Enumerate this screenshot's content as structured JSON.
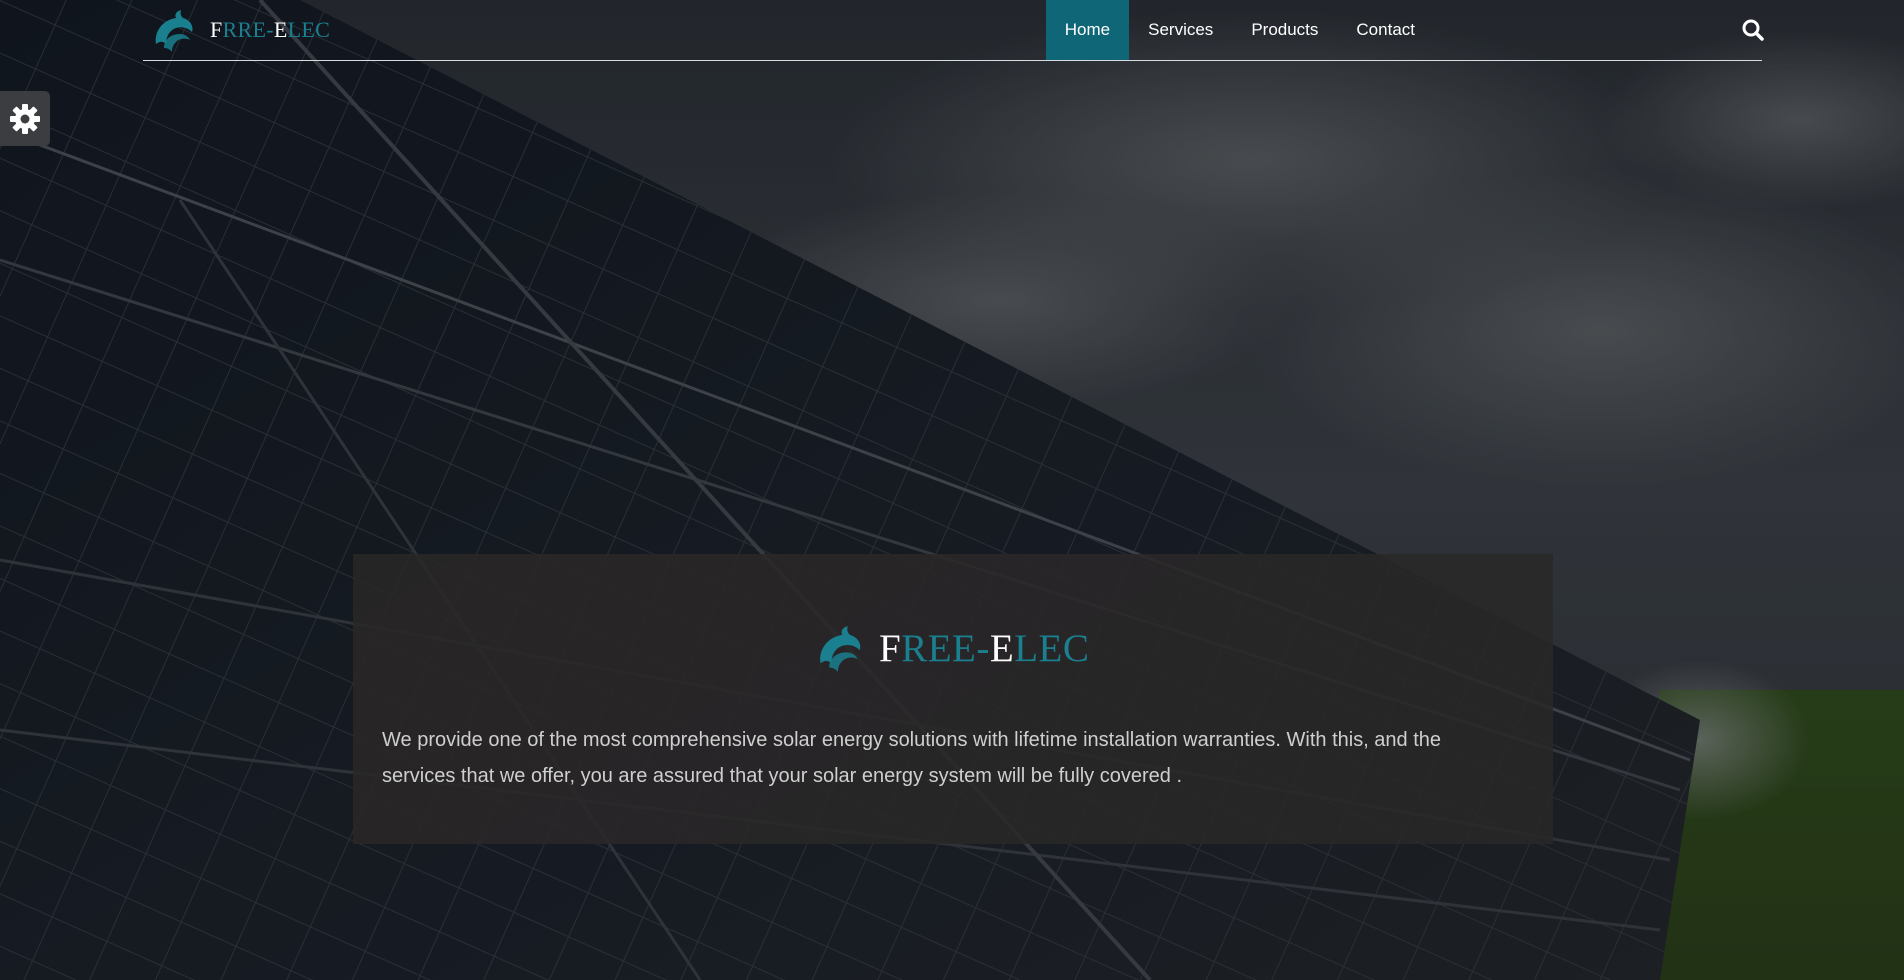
{
  "brand": {
    "parts": [
      "F",
      "RRE-",
      "E",
      "LEC"
    ],
    "colors": {
      "accent": "#1a7f8e",
      "white": "#ffffff"
    }
  },
  "nav": {
    "items": [
      {
        "label": "Home",
        "active": true
      },
      {
        "label": "Services",
        "active": false
      },
      {
        "label": "Products",
        "active": false
      },
      {
        "label": "Contact",
        "active": false
      }
    ],
    "search_icon": "search-icon",
    "active_color": "#0e6676"
  },
  "settings": {
    "icon": "gear-icon"
  },
  "hero": {
    "background": "solar-panels-photo",
    "card": {
      "brand_parts": [
        "F",
        "REE-",
        "E",
        "LEC"
      ],
      "description": "We provide one of the most comprehensive solar energy solutions with lifetime installation warranties. With this, and the services that we offer, you are assured that your solar energy system will be fully covered ."
    }
  }
}
